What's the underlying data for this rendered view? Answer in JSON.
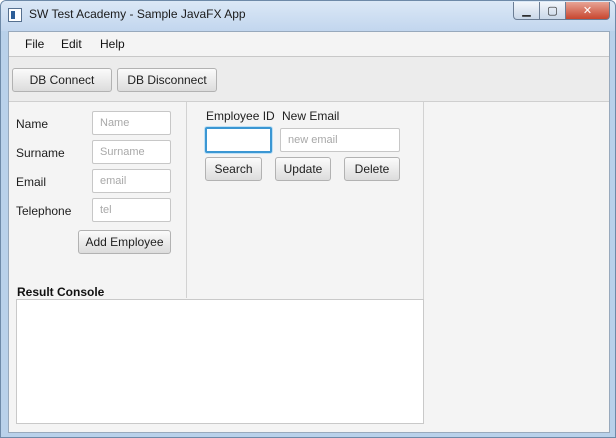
{
  "window": {
    "title": "SW Test Academy - Sample JavaFX App",
    "min_glyph": "▁",
    "max_glyph": "▢",
    "close_glyph": "✕"
  },
  "menu": [
    "File",
    "Edit",
    "Help"
  ],
  "toolbar": {
    "db_connect": "DB Connect",
    "db_disconnect": "DB Disconnect"
  },
  "employee_form": {
    "fields": [
      {
        "label": "Name",
        "placeholder": "Name"
      },
      {
        "label": "Surname",
        "placeholder": "Surname"
      },
      {
        "label": "Email",
        "placeholder": "email"
      },
      {
        "label": "Telephone",
        "placeholder": "tel"
      }
    ],
    "add_button": "Add Employee"
  },
  "search_panel": {
    "employee_id_label": "Employee ID",
    "employee_id_value": "",
    "new_email_label": "New Email",
    "new_email_placeholder": "new email",
    "search": "Search",
    "update": "Update",
    "delete": "Delete"
  },
  "console": {
    "title": "Result Console",
    "content": ""
  }
}
